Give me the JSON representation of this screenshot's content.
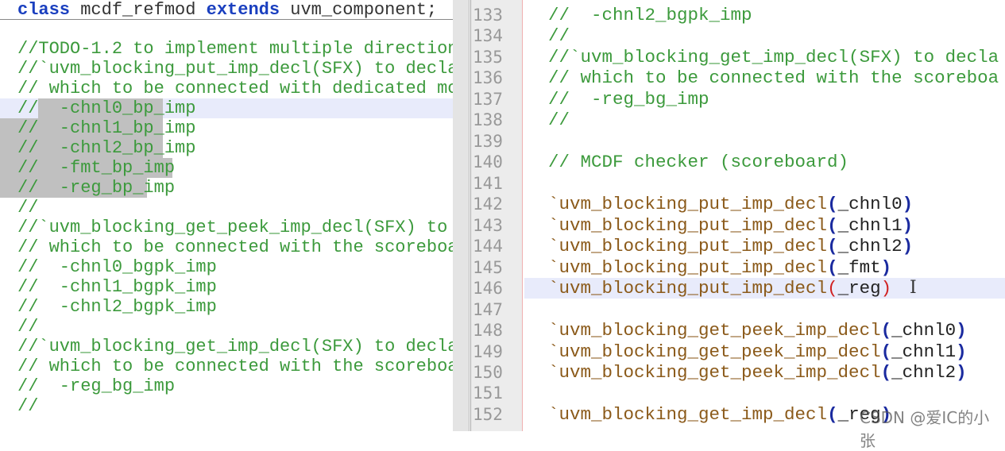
{
  "left_pane": {
    "header": {
      "kw1": "class",
      "name": " mcdf_refmod ",
      "kw2": "extends",
      "rest": " uvm_component;"
    },
    "lines": [
      "",
      "//TODO-1.2 to implement multiple direction",
      "//`uvm_blocking_put_imp_decl(SFX) to decla",
      "// which to be connected with dedicated mo",
      "//  -chnl0_bp_imp",
      "//  -chnl1_bp_imp",
      "//  -chnl2_bp_imp",
      "//  -fmt_bp_imp",
      "//  -reg_bp_imp",
      "//",
      "//`uvm_blocking_get_peek_imp_decl(SFX) to",
      "// which to be connected with the scoreboa",
      "//  -chnl0_bgpk_imp",
      "//  -chnl1_bgpk_imp",
      "//  -chnl2_bgpk_imp",
      "//",
      "//`uvm_blocking_get_imp_decl(SFX) to decla",
      "// which to be connected with the scoreboa",
      "//  -reg_bg_imp",
      "//"
    ]
  },
  "right_pane": {
    "line_numbers": [
      "133",
      "134",
      "135",
      "136",
      "137",
      "138",
      "139",
      "140",
      "141",
      "142",
      "143",
      "144",
      "145",
      "146",
      "147",
      "148",
      "149",
      "150",
      "151",
      "152"
    ],
    "comments": {
      "133": "//  -chnl2_bgpk_imp",
      "134": "//",
      "135": "//`uvm_blocking_get_imp_decl(SFX) to decla",
      "136": "// which to be connected with the scoreboa",
      "137": "//  -reg_bg_imp",
      "138": "//",
      "140": "// MCDF checker (scoreboard)"
    },
    "macros": {
      "142": {
        "macro": "`uvm_blocking_put_imp_decl",
        "arg": "_chnl0"
      },
      "143": {
        "macro": "`uvm_blocking_put_imp_decl",
        "arg": "_chnl1"
      },
      "144": {
        "macro": "`uvm_blocking_put_imp_decl",
        "arg": "_chnl2"
      },
      "145": {
        "macro": "`uvm_blocking_put_imp_decl",
        "arg": "_fmt"
      },
      "146": {
        "macro": "`uvm_blocking_put_imp_decl",
        "arg": "_reg"
      },
      "148": {
        "macro": "`uvm_blocking_get_peek_imp_decl",
        "arg": "_chnl0"
      },
      "149": {
        "macro": "`uvm_blocking_get_peek_imp_decl",
        "arg": "_chnl1"
      },
      "150": {
        "macro": "`uvm_blocking_get_peek_imp_decl",
        "arg": "_chnl2"
      },
      "152": {
        "macro": "`uvm_blocking_get_imp_decl",
        "arg": "_reg"
      }
    },
    "paren_open": "(",
    "paren_close": ")",
    "text_cursor_icon": "I"
  },
  "watermark": "CSDN @爱IC的小张",
  "colors": {
    "comment": "#3c9a3c",
    "keyword": "#1a3fbf",
    "macro": "#8b5a1a",
    "current_line": "#e8ebfb",
    "selection": "#c0c0c0"
  }
}
